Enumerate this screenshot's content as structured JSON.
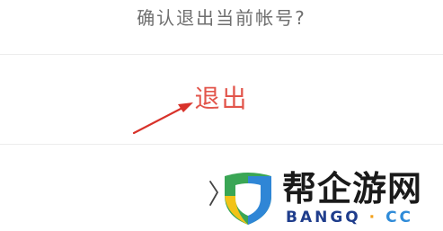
{
  "dialog": {
    "prompt": "确认退出当前帐号?",
    "logout_label": "退出"
  },
  "watermark": {
    "title": "帮企游网",
    "sub_left": "BANGQ",
    "sub_dot": "·",
    "sub_right": "CC"
  },
  "colors": {
    "prompt": "#6f6f6f",
    "logout": "#e2554b",
    "arrow": "#d8322a",
    "divider": "#ececec"
  },
  "icons": [
    "annotation-arrow-icon",
    "bangq-logo-icon"
  ]
}
